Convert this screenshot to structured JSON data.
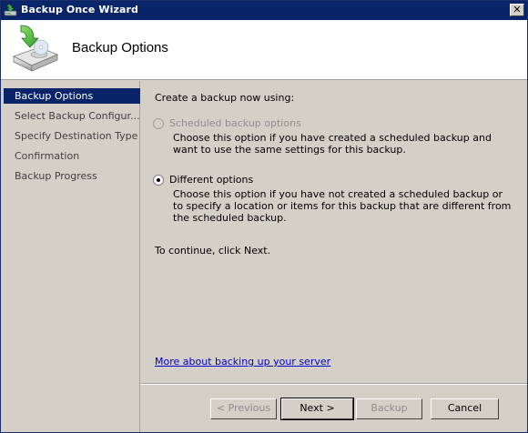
{
  "window": {
    "title": "Backup Once Wizard",
    "close_glyph": "✕"
  },
  "header": {
    "title": "Backup Options",
    "icon": "backup-drive-icon"
  },
  "sidebar": {
    "items": [
      {
        "label": "Backup Options",
        "active": true
      },
      {
        "label": "Select Backup Configur...",
        "active": false
      },
      {
        "label": "Specify Destination Type",
        "active": false
      },
      {
        "label": "Confirmation",
        "active": false
      },
      {
        "label": "Backup Progress",
        "active": false
      }
    ]
  },
  "content": {
    "prompt": "Create a backup now using:",
    "options": [
      {
        "label": "Scheduled backup options",
        "selected": false,
        "enabled": false,
        "description": "Choose this option if you have created a scheduled backup and want to use the same settings for this backup."
      },
      {
        "label": "Different options",
        "selected": true,
        "enabled": true,
        "description": "Choose this option if you have not created a scheduled backup or to specify a location or items for this backup that are different from the scheduled backup."
      }
    ],
    "continue_text": "To continue, click Next.",
    "more_link": "More about backing up your server"
  },
  "buttons": {
    "previous": "< Previous",
    "next": "Next >",
    "backup": "Backup",
    "cancel": "Cancel"
  },
  "colors": {
    "title_bar": "#0a246a",
    "selected_step": "#0a246a",
    "link": "#0000cc"
  }
}
